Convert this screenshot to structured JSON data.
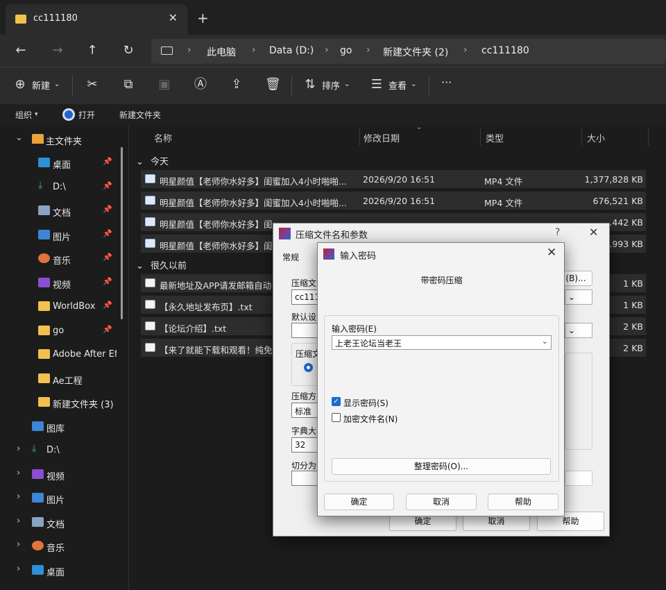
{
  "window": {
    "tab_title": "cc111180",
    "new_tab": "+",
    "tab_close": "✕"
  },
  "nav": {
    "back": "←",
    "forward": "→",
    "up": "↑",
    "refresh": "↻"
  },
  "breadcrumb": [
    "此电脑",
    "Data (D:)",
    "go",
    "新建文件夹 (2)",
    "cc111180"
  ],
  "toolbar": {
    "new": "新建",
    "sort": "排序",
    "view": "查看",
    "more": "···"
  },
  "subbar": {
    "organize": "组织",
    "open": "打开",
    "new_folder": "新建文件夹"
  },
  "sidebar": {
    "home": "主文件夹",
    "quick": [
      {
        "label": "桌面",
        "pinned": true
      },
      {
        "label": "D:\\",
        "pinned": true
      },
      {
        "label": "文档",
        "pinned": true
      },
      {
        "label": "图片",
        "pinned": true
      },
      {
        "label": "音乐",
        "pinned": true
      },
      {
        "label": "视频",
        "pinned": true
      },
      {
        "label": "WorldBox",
        "pinned": true
      },
      {
        "label": "go",
        "pinned": true
      },
      {
        "label": "Adobe After Ef",
        "pinned": false
      },
      {
        "label": "Ae工程",
        "pinned": false
      },
      {
        "label": "新建文件夹 (3)",
        "pinned": false
      }
    ],
    "gallery": "图库",
    "bottom": [
      "D:\\",
      "视频",
      "图片",
      "文档",
      "音乐",
      "桌面"
    ]
  },
  "columns": {
    "name": "名称",
    "date": "修改日期",
    "type": "类型",
    "size": "大小"
  },
  "groups": {
    "today": "今天",
    "long_ago": "很久以前"
  },
  "files_today": [
    {
      "name": "明星颜值【老师你水好多】闺蜜加入4小时啪啪...",
      "date": "2026/9/20 16:51",
      "type": "MP4 文件",
      "size": "1,377,828 KB"
    },
    {
      "name": "明星颜值【老师你水好多】闺蜜加入4小时啪啪...",
      "date": "2026/9/20 16:51",
      "type": "MP4 文件",
      "size": "676,521 KB"
    },
    {
      "name": "明星颜值【老师你水好多】闺",
      "date": "",
      "type": "",
      "size": "...442 KB"
    },
    {
      "name": "明星颜值【老师你水好多】闺",
      "date": "",
      "type": "",
      "size": "...993 KB"
    }
  ],
  "files_old": [
    {
      "name": "最新地址及APP请发邮箱自动",
      "size": "1 KB"
    },
    {
      "name": "【永久地址发布页】.txt",
      "size": "1 KB"
    },
    {
      "name": "【论坛介绍】.txt",
      "size": "2 KB"
    },
    {
      "name": "【来了就能下载和观看！纯免",
      "size": "2 KB"
    }
  ],
  "compress_dialog": {
    "title": "压缩文件名和参数",
    "help": "?",
    "close": "✕",
    "tab_general": "常规",
    "label_archive": "压缩文件",
    "archive_value": "cc1111",
    "browse": "(B)...",
    "label_default": "默认设",
    "label_format": "压缩文",
    "label_method": "压缩方",
    "method_value": "标准",
    "label_dict": "字典大小",
    "dict_value": "32",
    "label_split": "切分为分",
    "ok": "确定",
    "cancel": "取消",
    "help_btn": "帮助"
  },
  "password_dialog": {
    "title": "输入密码",
    "close": "✕",
    "heading": "带密码压缩",
    "label_password": "输入密码(E)",
    "password_value": "上老王论坛当老王",
    "show_password": "显示密码(S)",
    "show_password_checked": true,
    "encrypt_names": "加密文件名(N)",
    "encrypt_names_checked": false,
    "organize": "整理密码(O)...",
    "ok": "确定",
    "cancel": "取消",
    "help": "帮助"
  },
  "colors": {
    "accent": "#1b6ad2",
    "folder": "#f2c14e"
  }
}
